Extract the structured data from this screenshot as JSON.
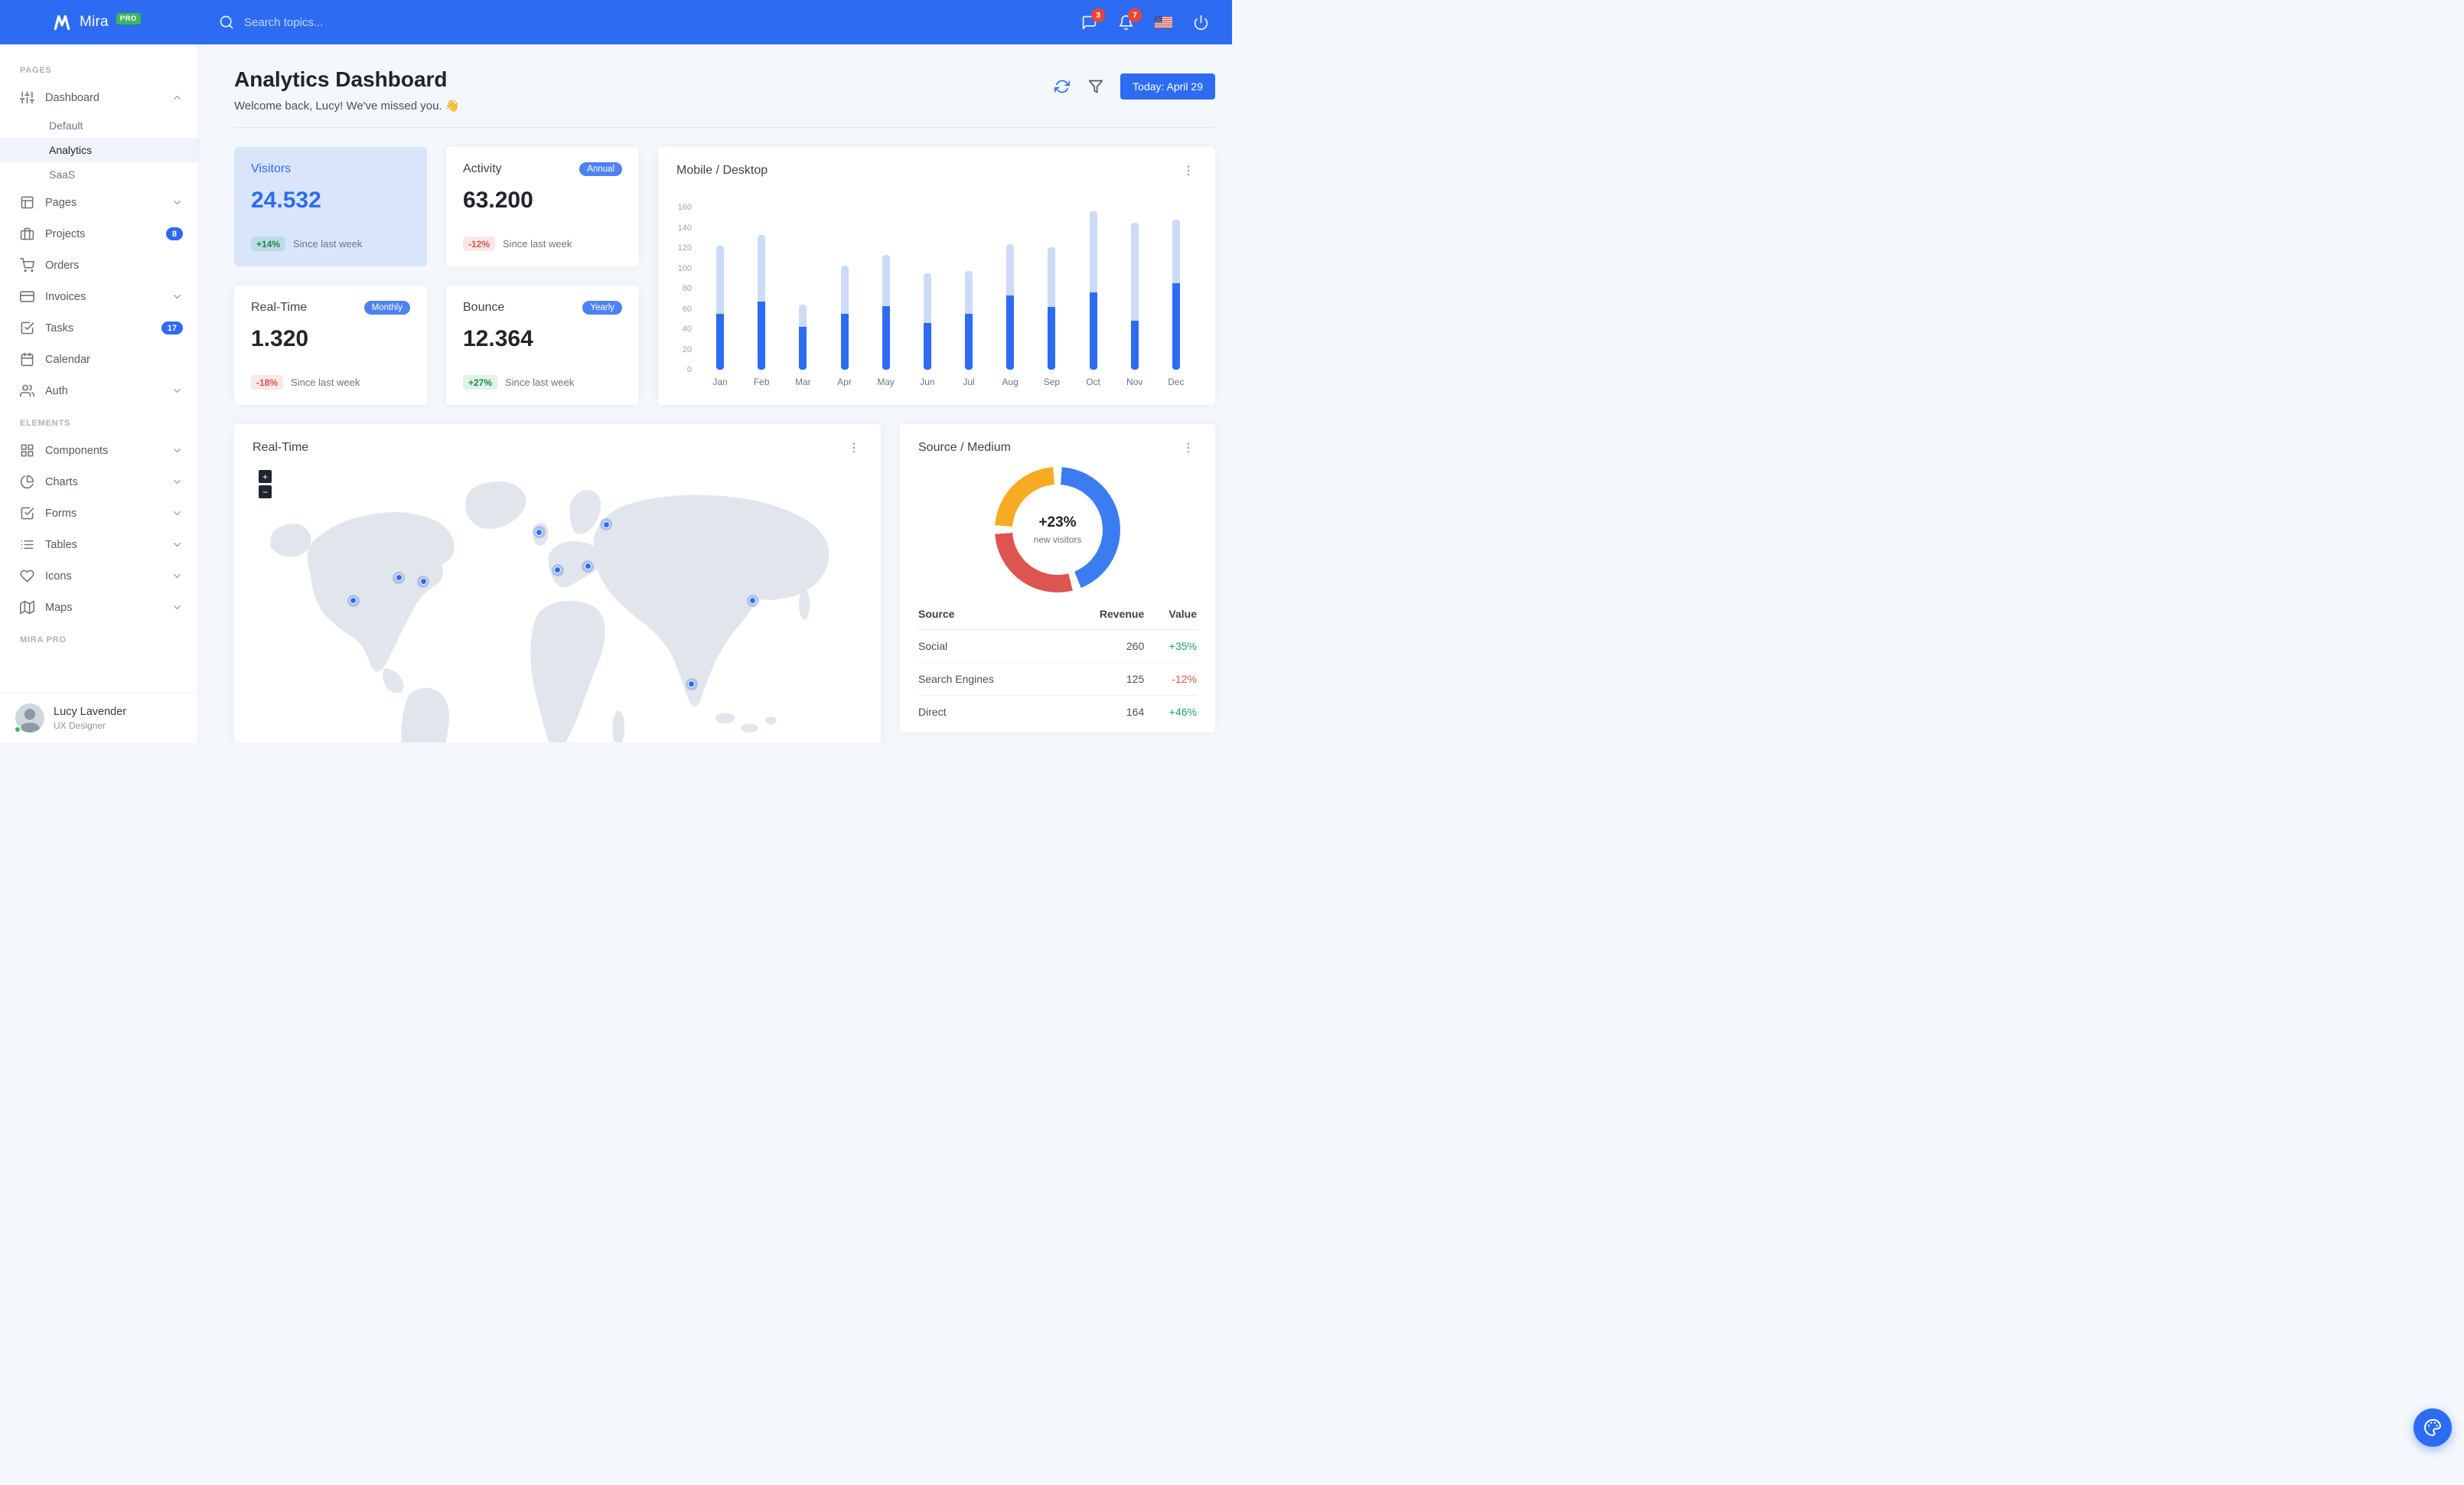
{
  "navbar": {
    "brand": "Mira",
    "badge": "PRO",
    "search_placeholder": "Search topics...",
    "messages_count": "3",
    "notifications_count": "7"
  },
  "sidebar": {
    "sections": [
      {
        "label": "PAGES",
        "items": [
          {
            "icon": "sliders",
            "label": "Dashboard",
            "chevron": "up",
            "children": [
              {
                "label": "Default",
                "active": false
              },
              {
                "label": "Analytics",
                "active": true
              },
              {
                "label": "SaaS",
                "active": false
              }
            ]
          },
          {
            "icon": "layout",
            "label": "Pages",
            "chevron": "down"
          },
          {
            "icon": "briefcase",
            "label": "Projects",
            "pill": "8"
          },
          {
            "icon": "shopping-cart",
            "label": "Orders"
          },
          {
            "icon": "credit-card",
            "label": "Invoices",
            "chevron": "down"
          },
          {
            "icon": "check-square",
            "label": "Tasks",
            "pill": "17"
          },
          {
            "icon": "calendar",
            "label": "Calendar"
          },
          {
            "icon": "users",
            "label": "Auth",
            "chevron": "down"
          }
        ]
      },
      {
        "label": "ELEMENTS",
        "items": [
          {
            "icon": "grid",
            "label": "Components",
            "chevron": "down"
          },
          {
            "icon": "pie-chart",
            "label": "Charts",
            "chevron": "down"
          },
          {
            "icon": "check-square",
            "label": "Forms",
            "chevron": "down"
          },
          {
            "icon": "list",
            "label": "Tables",
            "chevron": "down"
          },
          {
            "icon": "heart",
            "label": "Icons",
            "chevron": "down"
          },
          {
            "icon": "map",
            "label": "Maps",
            "chevron": "down"
          }
        ]
      },
      {
        "label": "MIRA PRO",
        "items": []
      }
    ],
    "user": {
      "name": "Lucy Lavender",
      "role": "UX Designer"
    }
  },
  "page": {
    "title": "Analytics Dashboard",
    "subtitle": "Welcome back, Lucy! We've missed you. 👋",
    "today_button": "Today: April 29"
  },
  "stats": [
    {
      "title": "Visitors",
      "value": "24.532",
      "delta": "+14%",
      "note": "Since last week"
    },
    {
      "title": "Activity",
      "badge": "Annual",
      "value": "63.200",
      "delta": "-12%",
      "note": "Since last week"
    },
    {
      "title": "Real-Time",
      "badge": "Monthly",
      "value": "1.320",
      "delta": "-18%",
      "note": "Since last week"
    },
    {
      "title": "Bounce",
      "badge": "Yearly",
      "value": "12.364",
      "delta": "+27%",
      "note": "Since last week"
    }
  ],
  "chart_data": [
    {
      "type": "bar",
      "title": "Mobile / Desktop",
      "stacked": true,
      "categories": [
        "Jan",
        "Feb",
        "Mar",
        "Apr",
        "May",
        "Jun",
        "Jul",
        "Aug",
        "Sep",
        "Oct",
        "Nov",
        "Dec"
      ],
      "series": [
        {
          "name": "Mobile",
          "color": "#2d6bf3",
          "values": [
            55,
            67,
            42,
            55,
            63,
            46,
            55,
            73,
            62,
            76,
            48,
            85
          ]
        },
        {
          "name": "Desktop",
          "color": "#ccdbf7",
          "values": [
            67,
            66,
            22,
            48,
            50,
            49,
            42,
            51,
            59,
            80,
            97,
            63
          ]
        }
      ],
      "xlabel": "",
      "ylabel": "",
      "ylim": [
        0,
        160
      ],
      "yticks": [
        0,
        20,
        40,
        60,
        80,
        100,
        120,
        140,
        160
      ],
      "grid": false,
      "legend": "none"
    },
    {
      "type": "pie",
      "donut": true,
      "title": "Source / Medium",
      "center_label": "+23%",
      "center_sublabel": "new visitors",
      "slices": [
        {
          "value": 45,
          "color": "#3b7df0"
        },
        {
          "value": 30,
          "color": "#dd5450"
        },
        {
          "value": 25,
          "color": "#f8ab22"
        }
      ]
    }
  ],
  "realtime_map": {
    "title": "Real-Time",
    "zoom_in": "+",
    "zoom_out": "−",
    "markers": [
      {
        "x": 16.5,
        "y": 36
      },
      {
        "x": 24,
        "y": 30
      },
      {
        "x": 28,
        "y": 31
      },
      {
        "x": 47,
        "y": 18
      },
      {
        "x": 50,
        "y": 28
      },
      {
        "x": 55,
        "y": 27
      },
      {
        "x": 58,
        "y": 16
      },
      {
        "x": 72,
        "y": 58
      },
      {
        "x": 82,
        "y": 36
      }
    ]
  },
  "source_medium": {
    "title": "Source / Medium",
    "headers": [
      "Source",
      "Revenue",
      "Value"
    ],
    "rows": [
      {
        "source": "Social",
        "revenue": "260",
        "value": "+35%",
        "dir": "up"
      },
      {
        "source": "Search Engines",
        "revenue": "125",
        "value": "-12%",
        "dir": "down"
      },
      {
        "source": "Direct",
        "revenue": "164",
        "value": "+46%",
        "dir": "up"
      }
    ]
  }
}
